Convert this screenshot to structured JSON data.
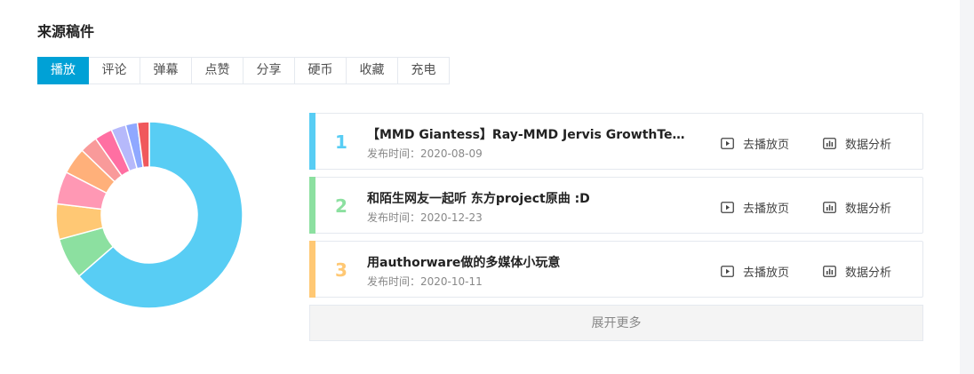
{
  "title": "来源稿件",
  "tabs": [
    "播放",
    "评论",
    "弹幕",
    "点赞",
    "分享",
    "硬币",
    "收藏",
    "充电"
  ],
  "active_tab": 0,
  "donut": {
    "values": [
      62,
      7,
      6,
      5.5,
      4.5,
      3,
      3,
      2.5,
      2,
      2
    ],
    "colors": [
      "#58cdf4",
      "#8ce0a0",
      "#ffc874",
      "#ff98b4",
      "#ffb07a",
      "#f99a9a",
      "#ff6fa2",
      "#b6b9fb",
      "#8fa8ff",
      "#f0585c"
    ]
  },
  "videos": [
    {
      "rank": "1",
      "title": "【MMD Giantess】Ray-MMD Jervis GrowthTest ...",
      "date": "发布时间：2020-08-09",
      "color": "#58cdf4"
    },
    {
      "rank": "2",
      "title": "和陌生网友一起听 东方project原曲 :D",
      "date": "发布时间：2020-12-23",
      "color": "#8ce0a0"
    },
    {
      "rank": "3",
      "title": "用authorware做的多媒体小玩意",
      "date": "发布时间：2020-10-11",
      "color": "#ffc874"
    }
  ],
  "actions": {
    "play": "去播放页",
    "analysis": "数据分析"
  },
  "more": "展开更多",
  "icons": {
    "play": "play-icon",
    "analysis": "bar-chart-icon"
  }
}
